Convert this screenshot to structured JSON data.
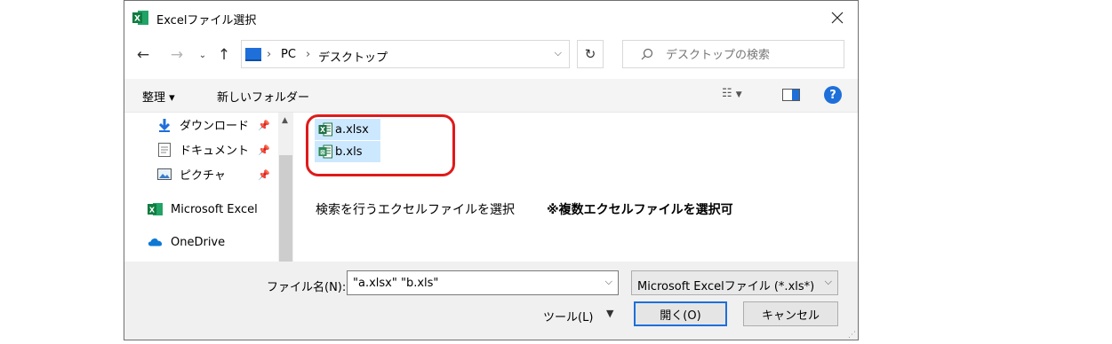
{
  "window": {
    "title": "Excelファイル選択"
  },
  "address": {
    "crumbs": [
      "PC",
      "デスクトップ"
    ]
  },
  "search": {
    "placeholder": "デスクトップの検索"
  },
  "toolbar": {
    "organize": "整理 ▾",
    "new_folder": "新しいフォルダー"
  },
  "nav": {
    "items": [
      {
        "label": "ダウンロード",
        "icon": "download-arrow-icon",
        "pinned": true
      },
      {
        "label": "ドキュメント",
        "icon": "document-icon",
        "pinned": true
      },
      {
        "label": "ピクチャ",
        "icon": "picture-icon",
        "pinned": true
      },
      {
        "label": "Microsoft Excel",
        "icon": "excel-icon",
        "pinned": false
      },
      {
        "label": "OneDrive",
        "icon": "cloud-icon",
        "pinned": false
      }
    ]
  },
  "files": [
    {
      "name": "a.xlsx",
      "icon": "xlsx-icon",
      "selected": true
    },
    {
      "name": "b.xls",
      "icon": "xls-icon",
      "selected": true
    }
  ],
  "annotation": {
    "note": "検索を行うエクセルファイルを選択",
    "note_bold": "※複数エクセルファイルを選択可",
    "highlight_color": "#e01a1a"
  },
  "footer": {
    "filename_label": "ファイル名(N):",
    "filename_value": "\"a.xlsx\" \"b.xls\"",
    "filetype_value": "Microsoft Excelファイル (*.xls*)",
    "tools_label": "ツール(L)",
    "open_label": "開く(O)",
    "cancel_label": "キャンセル"
  },
  "colors": {
    "accent": "#1e6fd9",
    "selection": "#cce8ff",
    "excel_green": "#1d7044"
  }
}
